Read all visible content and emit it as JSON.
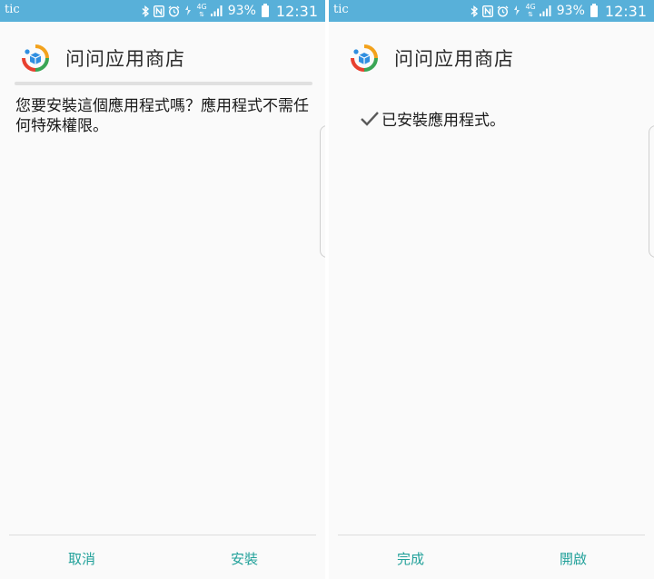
{
  "status_bar": {
    "carrier": "tic",
    "battery_percent": "93%",
    "time": "12:31",
    "network": "4G",
    "icons": [
      "bluetooth-icon",
      "nfc-icon",
      "alarm-icon",
      "data-arrows-icon",
      "signal-icon",
      "battery-icon"
    ],
    "color": "#58b0d9"
  },
  "app": {
    "title": "问问应用商店",
    "accent": "#22a19a"
  },
  "install_screen": {
    "prompt": "您要安裝這個應用程式嗎？應用程式不需任何特殊權限。",
    "cancel_label": "取消",
    "install_label": "安裝"
  },
  "installed_screen": {
    "message": "已安裝應用程式。",
    "done_label": "完成",
    "open_label": "開啟"
  }
}
